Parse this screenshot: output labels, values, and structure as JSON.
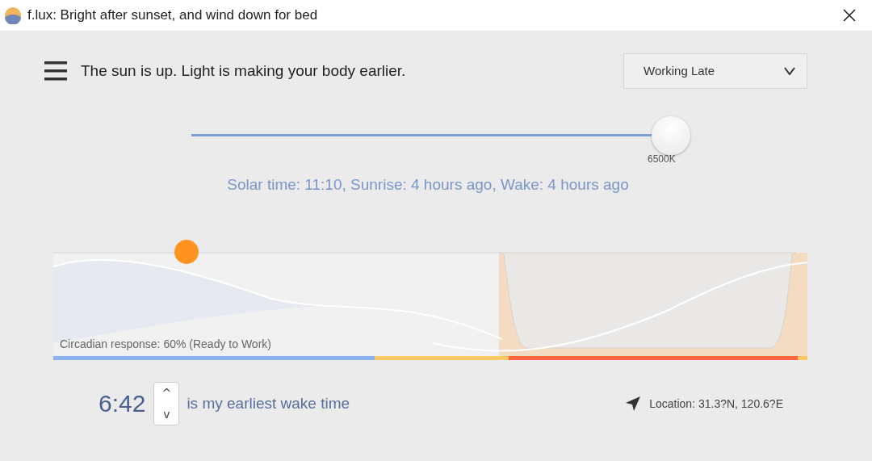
{
  "window": {
    "title": "f.lux: Bright after sunset, and wind down for bed"
  },
  "header": {
    "status": "The sun is up. Light is making your body earlier.",
    "mode_dropdown": {
      "value": "Working Late"
    }
  },
  "color_slider": {
    "level": 1,
    "reading": "6500K"
  },
  "solar_info": "Solar time: 11:10, Sunrise: 4 hours ago, Wake: 4 hours ago",
  "circadian": {
    "response": "Circadian response: 60% (Ready to Work)"
  },
  "wake": {
    "time": "6:42",
    "label": "is my earliest wake time",
    "up": "^",
    "down": "v"
  },
  "location": "Location: 31.3?N, 120.6?E"
}
